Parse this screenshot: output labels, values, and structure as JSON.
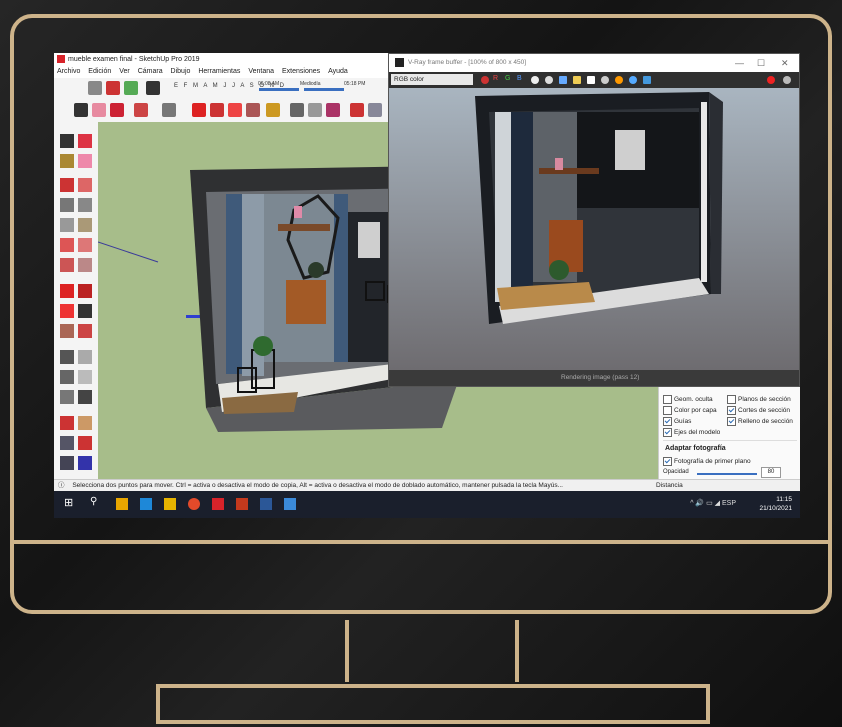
{
  "sketchup": {
    "title": "mueble examen final - SketchUp Pro 2019",
    "menu": [
      "Archivo",
      "Edición",
      "Ver",
      "Cámara",
      "Dibujo",
      "Herramientas",
      "Ventana",
      "Extensiones",
      "Ayuda"
    ],
    "months": "E F M A M J J A S O N D",
    "times": [
      "06:08 AM",
      "Mediodía",
      "05:18 PM"
    ],
    "status_text": "Selecciona dos puntos para mover. Ctrl = activa o desactiva el modo de copia, Alt = activa o desactiva el modo de doblado automático, mantener pulsada la tecla Mayús...",
    "status_measure": "Distancia"
  },
  "vray": {
    "title": "V-Ray frame buffer - [100% of 800 x 450]",
    "channel": "RGB color",
    "channel_letters": [
      "R",
      "G",
      "B"
    ],
    "status": "Rendering image (pass 12)"
  },
  "panel": {
    "checks": [
      {
        "label": "Geom. oculta",
        "checked": false
      },
      {
        "label": "Planos de sección",
        "checked": false
      },
      {
        "label": "Color por capa",
        "checked": false
      },
      {
        "label": "Cortes de sección",
        "checked": true
      },
      {
        "label": "Guías",
        "checked": true
      },
      {
        "label": "Relleno de sección",
        "checked": true
      },
      {
        "label": "Ejes del modelo",
        "checked": true
      }
    ],
    "section_title": "Adaptar fotografía",
    "photo_check": "Fotografía de primer plano",
    "opacity_label": "Opacidad",
    "opacity_value": "80"
  },
  "taskbar": {
    "lang": "ESP",
    "time": "11:15",
    "date": "21/10/2021"
  },
  "colors": {
    "frame": "#cdb38a",
    "viewport": "#a7bd8a",
    "render_bg": "#7b7a7d",
    "taskbar": "#1a1f2c"
  }
}
